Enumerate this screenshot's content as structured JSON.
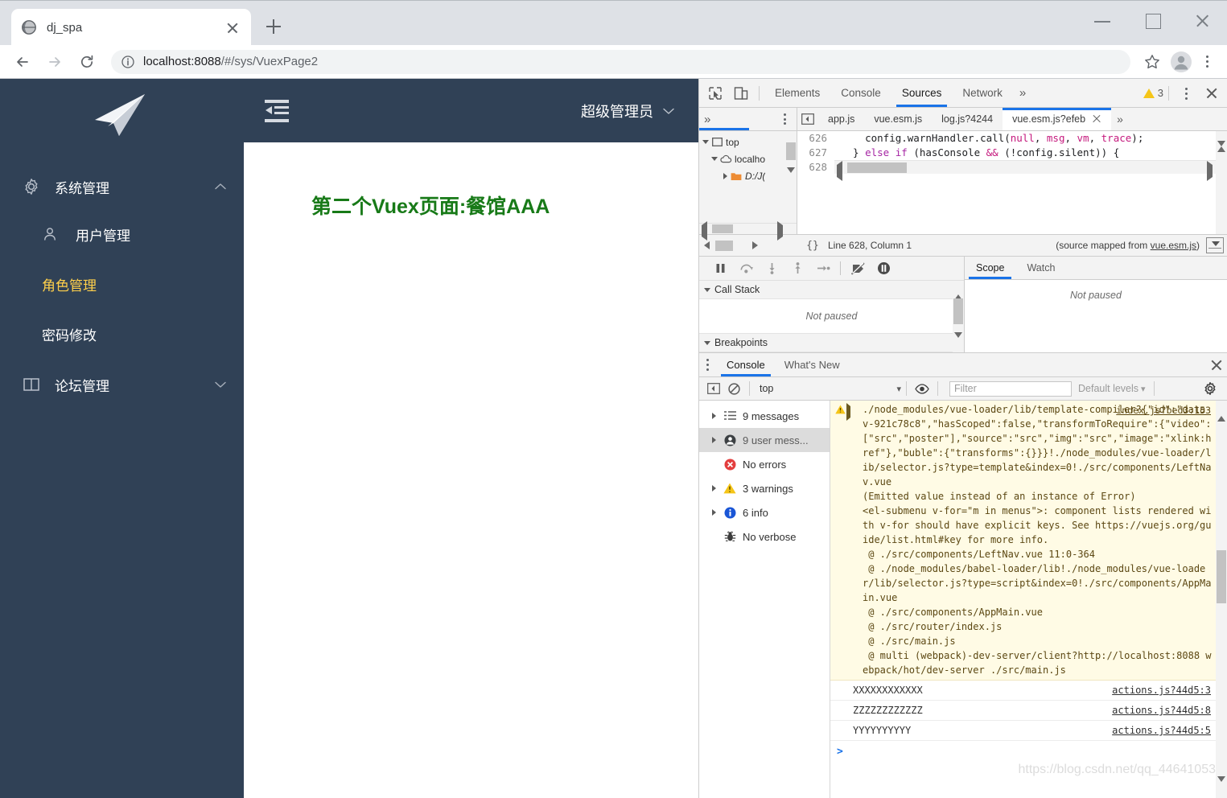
{
  "browser": {
    "tab": {
      "title": "dj_spa",
      "favicon": "globe-icon",
      "close": "×"
    },
    "newtab_label": "+",
    "url_scheme_host": "localhost:8088",
    "url_path": "/#/sys/VuexPage2",
    "url_full": "localhost:8088/#/sys/VuexPage2",
    "window": {
      "minimize": "—",
      "maximize": "□",
      "close": "✕"
    }
  },
  "app": {
    "sidebar": {
      "logo": "paper-plane-logo",
      "groups": [
        {
          "label": "系统管理",
          "icon": "gear-icon",
          "expanded": true,
          "chevron": "chevron-up-icon",
          "items": [
            {
              "label": "用户管理",
              "icon": "user-icon",
              "active": false
            },
            {
              "label": "角色管理",
              "icon": "",
              "active": true
            },
            {
              "label": "密码修改",
              "icon": "",
              "active": false
            }
          ]
        },
        {
          "label": "论坛管理",
          "icon": "book-icon",
          "expanded": false,
          "chevron": "chevron-down-icon",
          "items": []
        }
      ]
    },
    "header": {
      "collapse_icon": "collapse-sidebar-icon",
      "user": "超级管理员",
      "user_chevron": "chevron-down-icon"
    },
    "page": {
      "heading": "第二个Vuex页面:餐馆AAA",
      "heading_color": "#187a18"
    }
  },
  "devtools": {
    "inspect_icon": "inspect-element-icon",
    "device_icon": "device-toolbar-icon",
    "tabs": [
      {
        "label": "Elements",
        "active": false
      },
      {
        "label": "Console",
        "active": false
      },
      {
        "label": "Sources",
        "active": true
      },
      {
        "label": "Network",
        "active": false
      }
    ],
    "more_tabs": "»",
    "warning_count": "3",
    "menu_icon": "kebab-menu-icon",
    "close_icon": "close-icon",
    "navigator": {
      "more": "»",
      "menu": "kebab-menu-icon",
      "tree": [
        {
          "label": "top",
          "icon": "frame-icon",
          "depth": 0,
          "caret": "down"
        },
        {
          "label": "localho",
          "icon": "cloud-icon",
          "depth": 1,
          "caret": "down"
        },
        {
          "label": "D:/J(",
          "icon": "folder-icon",
          "depth": 2,
          "caret": "right"
        }
      ]
    },
    "editor": {
      "tabs": [
        {
          "label": "app.js",
          "active": false,
          "closable": false
        },
        {
          "label": "vue.esm.js",
          "active": false,
          "closable": false
        },
        {
          "label": "log.js?4244",
          "active": false,
          "closable": false
        },
        {
          "label": "vue.esm.js?efeb",
          "active": true,
          "closable": true
        }
      ],
      "more": "»",
      "lines": [
        {
          "no": "626",
          "text": "    config.warnHandler.call(null, msg, vm, trace);"
        },
        {
          "no": "627",
          "text": "  } else if (hasConsole && (!config.silent)) {"
        },
        {
          "no": "628",
          "text": ""
        }
      ]
    },
    "status": {
      "format_button": "{}",
      "position": "Line 628, Column 1",
      "source_map_prefix": "(source mapped from ",
      "source_map_link": "vue.esm.js",
      "source_map_suffix": ")"
    },
    "debugger": {
      "buttons": [
        "pause-resume-icon",
        "step-over-icon",
        "step-into-icon",
        "step-out-icon",
        "step-icon",
        "deactivate-breakpoints-icon",
        "pause-on-exceptions-icon"
      ],
      "call_stack_label": "Call Stack",
      "call_stack_value": "Not paused",
      "breakpoints_label": "Breakpoints",
      "scope_tab": "Scope",
      "watch_tab": "Watch",
      "scope_value": "Not paused"
    },
    "drawer": {
      "menu_icon": "kebab-menu-icon",
      "tabs": [
        {
          "label": "Console",
          "active": true
        },
        {
          "label": "What's New",
          "active": false
        }
      ],
      "close_icon": "close-icon",
      "toolbar": {
        "sidebar_toggle": "console-sidebar-toggle-icon",
        "clear": "clear-console-icon",
        "context": "top",
        "context_chevron": "▾",
        "eye_icon": "live-expression-icon",
        "filter_placeholder": "Filter",
        "filter_value": "",
        "levels": "Default levels",
        "levels_chevron": "▾",
        "settings_icon": "gear-icon"
      },
      "sidebar": [
        {
          "label": "9 messages",
          "icon": "list-icon",
          "expandable": true,
          "selected": false
        },
        {
          "label": "9 user mess...",
          "icon": "user-icon",
          "expandable": true,
          "selected": true
        },
        {
          "label": "No errors",
          "icon": "error-icon",
          "expandable": false,
          "selected": false
        },
        {
          "label": "3 warnings",
          "icon": "warning-icon",
          "expandable": true,
          "selected": false
        },
        {
          "label": "6 info",
          "icon": "info-icon",
          "expandable": true,
          "selected": false
        },
        {
          "label": "No verbose",
          "icon": "verbose-icon",
          "expandable": false,
          "selected": false
        }
      ],
      "warning_entry": {
        "icon": "warning-icon",
        "disclosure": "▸",
        "source": "index.js?bed3:153",
        "text": "./node_modules/vue-loader/lib/template-compiler?{\"id\":\"data-v-921c78c8\",\"hasScoped\":false,\"transformToRequire\":{\"video\":[\"src\",\"poster\"],\"source\":\"src\",\"img\":\"src\",\"image\":\"xlink:href\"},\"buble\":{\"transforms\":{}}}!./node_modules/vue-loader/lib/selector.js?type=template&index=0!./src/components/LeftNav.vue\n(Emitted value instead of an instance of Error)\n<el-submenu v-for=\"m in menus\">: component lists rendered with v-for should have explicit keys. See https://vuejs.org/guide/list.html#key for more info.\n @ ./src/components/LeftNav.vue 11:0-364\n @ ./node_modules/babel-loader/lib!./node_modules/vue-loader/lib/selector.js?type=script&index=0!./src/components/AppMain.vue\n @ ./src/components/AppMain.vue\n @ ./src/router/index.js\n @ ./src/main.js\n @ multi (webpack)-dev-server/client?http://localhost:8088 webpack/hot/dev-server ./src/main.js"
      },
      "log_entries": [
        {
          "message": "XXXXXXXXXXXX",
          "source": "actions.js?44d5:3"
        },
        {
          "message": "ZZZZZZZZZZZZ",
          "source": "actions.js?44d5:8"
        },
        {
          "message": "YYYYYYYYYY",
          "source": "actions.js?44d5:5"
        }
      ],
      "prompt": ">"
    }
  },
  "watermark": "https://blog.csdn.net/qq_44641053"
}
